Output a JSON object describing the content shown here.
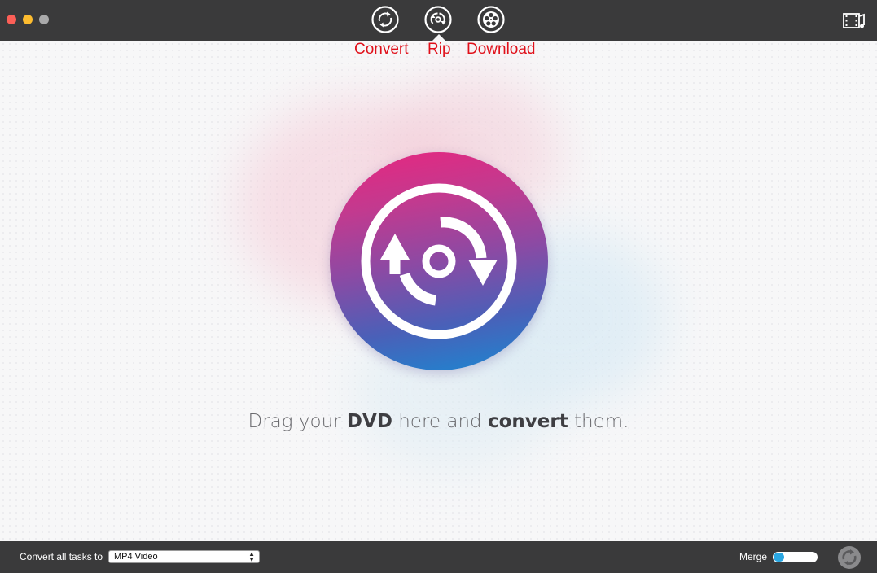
{
  "window": {
    "traffic_lights": [
      "close",
      "minimize",
      "zoom"
    ]
  },
  "nav": {
    "items": [
      {
        "label": "Convert",
        "icon": "convert-icon",
        "color": "#e0101a"
      },
      {
        "label": "Rip",
        "icon": "rip-icon",
        "color": "#e0101a",
        "selected": true
      },
      {
        "label": "Download",
        "icon": "download-icon",
        "color": "#e0101a"
      }
    ],
    "library_icon": "media-library-icon"
  },
  "main": {
    "drop_icon": "dvd-rip-icon",
    "instruction": {
      "part1": "Drag your ",
      "bold1": "DVD",
      "part2": " here and ",
      "bold2": "convert",
      "part3": " them."
    }
  },
  "bottom": {
    "convert_all_label": "Convert all tasks to",
    "format_value": "MP4 Video",
    "merge_label": "Merge",
    "merge_on": false,
    "convert_button_icon": "convert-start-icon",
    "accent": "#2aa7e2"
  }
}
